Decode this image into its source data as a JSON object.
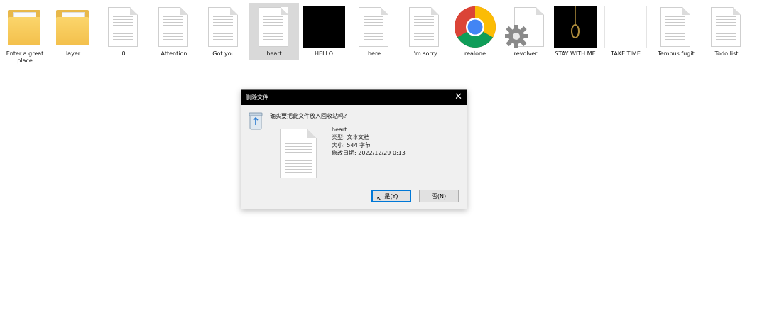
{
  "desktop": {
    "items": [
      {
        "label": "Enter a great\nplace",
        "icon": "folder-icon"
      },
      {
        "label": "layer",
        "icon": "folder-icon"
      },
      {
        "label": "0",
        "icon": "text-document-icon"
      },
      {
        "label": "Attention",
        "icon": "text-document-icon"
      },
      {
        "label": "Got you",
        "icon": "text-document-icon"
      },
      {
        "label": "heart",
        "icon": "text-document-icon",
        "selected": true
      },
      {
        "label": "HELLO",
        "icon": "black-image-icon"
      },
      {
        "label": "here",
        "icon": "text-document-icon"
      },
      {
        "label": "I'm sorry",
        "icon": "text-document-icon"
      },
      {
        "label": "realone",
        "icon": "chrome-icon"
      },
      {
        "label": "revolver",
        "icon": "settings-file-icon"
      },
      {
        "label": "STAY WITH ME",
        "icon": "noose-image-icon"
      },
      {
        "label": "TAKE TIME",
        "icon": "blank-image-icon"
      },
      {
        "label": "Tempus fugit",
        "icon": "text-document-icon"
      },
      {
        "label": "Todo list",
        "icon": "text-document-icon"
      }
    ]
  },
  "dialog": {
    "title": "删除文件",
    "question": "确实要把此文件放入回收站吗?",
    "file_name": "heart",
    "file_type": "类型: 文本文档",
    "file_size": "大小: 544 字节",
    "file_modified": "修改日期: 2022/12/29 0:13",
    "yes_label": "是(Y)",
    "no_label": "否(N)",
    "close_label": "✕"
  },
  "colors": {
    "titlebar": "#000000",
    "selection": "#d9d9d9",
    "accent": "#0078d7",
    "folder": "#f3c04c"
  }
}
